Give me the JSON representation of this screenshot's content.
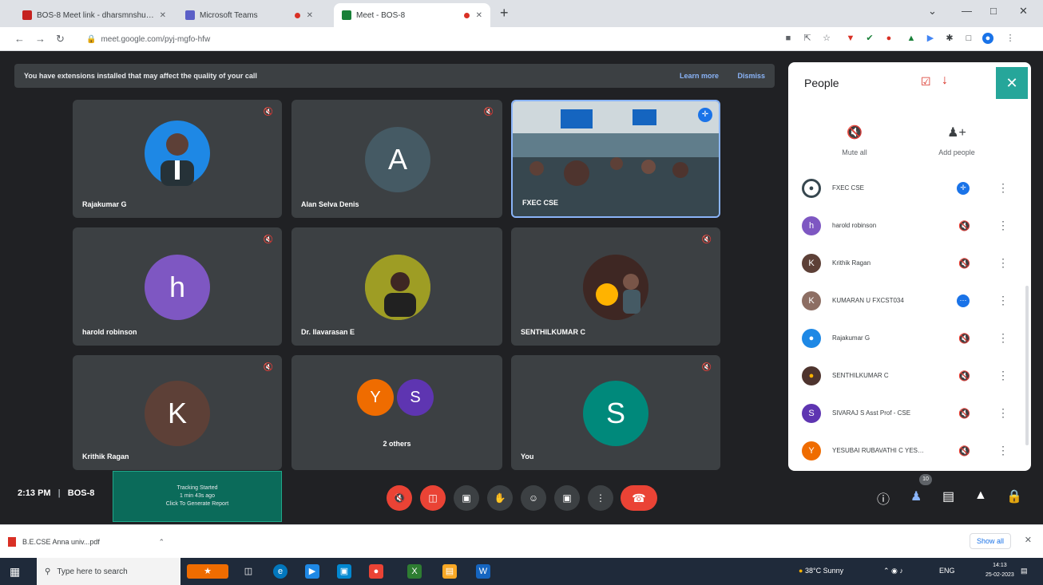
{
  "browser": {
    "tabs": [
      {
        "label": "BOS-8 Meet link - dharsmnshu…",
        "color": "#c5221f"
      },
      {
        "label": "Microsoft Teams",
        "color": "#5b5fc7"
      },
      {
        "label": "Meet - BOS-8",
        "color": "#188038"
      }
    ],
    "tab_close": "✕",
    "new_tab": "+",
    "url": "meet.google.com/pyj-mgfo-hfw"
  },
  "meet": {
    "banner_text": "You have extensions installed that may affect the quality of your call",
    "learn_more": "Learn more",
    "dismiss": "Dismiss",
    "tiles": [
      {
        "name": "Rajakumar G",
        "initial": "",
        "color": "#1e88e5"
      },
      {
        "name": "Alan Selva Denis",
        "initial": "A",
        "color": "#455a64"
      },
      {
        "name": "FXEC CSE",
        "initial": "",
        "color": "#546e7a"
      },
      {
        "name": "harold robinson",
        "initial": "h",
        "color": "#7e57c2"
      },
      {
        "name": "Dr. Ilavarasan E",
        "initial": "",
        "color": "#6d4c41"
      },
      {
        "name": "SENTHILKUMAR C",
        "initial": "",
        "color": "#4e342e"
      },
      {
        "name": "Krithik Ragan",
        "initial": "K",
        "color": "#5d4037"
      },
      {
        "name": "You",
        "initial": "S",
        "color": "#00897b"
      }
    ],
    "others": {
      "initials": [
        "Y",
        "S"
      ],
      "colors": [
        "#ef6c00",
        "#5e35b1"
      ],
      "label": "2 others"
    },
    "time": "2:13 PM",
    "separator": "|",
    "meeting_code": "BOS-8",
    "tracking": {
      "line1": "Tracking Started",
      "line2": "1 min 43s ago",
      "line3": "Click To Generate Report"
    },
    "participant_count": "10"
  },
  "people": {
    "title": "People",
    "close": "✕",
    "mute_all": "Mute all",
    "add_people": "Add people",
    "list": [
      {
        "name": "FXEC CSE",
        "initial": "",
        "color": "#37474f",
        "status": "pin"
      },
      {
        "name": "harold robinson",
        "initial": "h",
        "color": "#7e57c2",
        "status": "muted"
      },
      {
        "name": "Krithik Ragan",
        "initial": "K",
        "color": "#5d4037",
        "status": "muted"
      },
      {
        "name": "KUMARAN U FXCST034",
        "initial": "K",
        "color": "#8d6e63",
        "status": "speaking"
      },
      {
        "name": "Rajakumar G",
        "initial": "",
        "color": "#1e88e5",
        "status": "muted"
      },
      {
        "name": "SENTHILKUMAR C",
        "initial": "",
        "color": "#4e342e",
        "status": "muted"
      },
      {
        "name": "SIVARAJ S Asst Prof - CSE",
        "initial": "S",
        "color": "#5e35b1",
        "status": "muted"
      },
      {
        "name": "YESUBAI RUBAVATHI C YES…",
        "initial": "Y",
        "color": "#ef6c00",
        "status": "muted"
      }
    ]
  },
  "downloads": {
    "file": "B.E.CSE Anna univ...pdf",
    "show_all": "Show all",
    "close": "✕"
  },
  "taskbar": {
    "search_placeholder": "Type here to search",
    "weather": "38°C Sunny",
    "lang": "ENG",
    "time": "14:13",
    "date": "25-02-2023"
  }
}
